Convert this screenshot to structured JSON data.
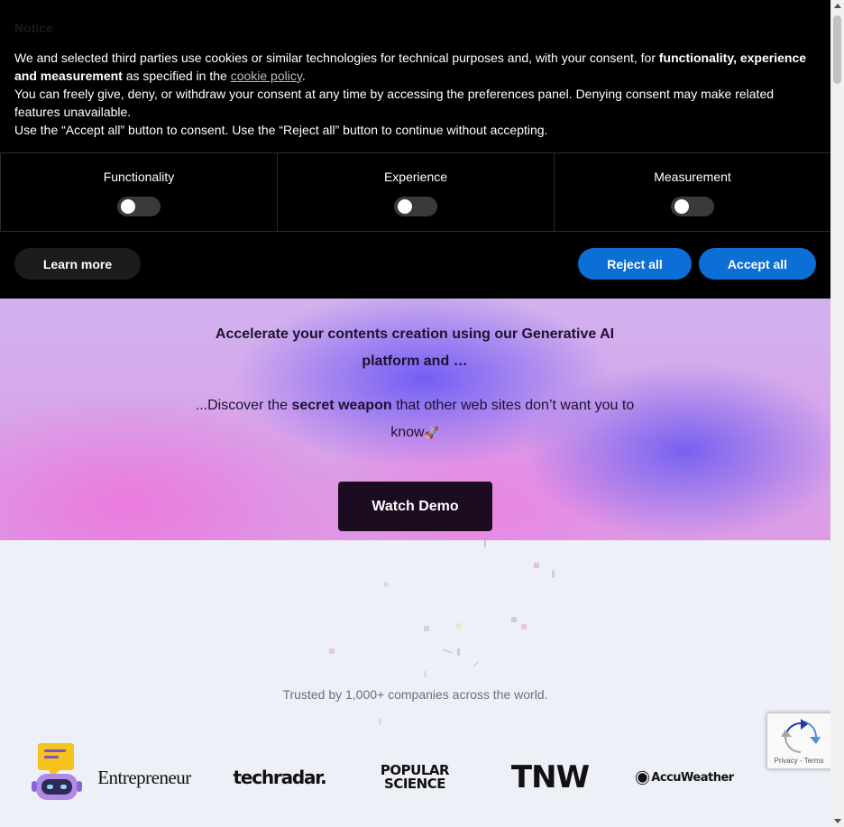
{
  "cookie_banner": {
    "title": "Notice",
    "text_part1": "We and selected third parties use cookies or similar technologies for technical purposes and, with your consent, for ",
    "text_bold": "functionality, experience and measurement",
    "text_part2": " as specified in the ",
    "policy_link": "cookie policy",
    "text_period": ".",
    "line2": "You can freely give, deny, or withdraw your consent at any time by accessing the preferences panel. Denying consent may make related features unavailable.",
    "line3": "Use the “Accept all” button to consent. Use the “Reject all” button to continue without accepting.",
    "preferences": [
      {
        "label": "Functionality",
        "enabled": false
      },
      {
        "label": "Experience",
        "enabled": false
      },
      {
        "label": "Measurement",
        "enabled": false
      }
    ],
    "learn_more_label": "Learn more",
    "reject_label": "Reject all",
    "accept_label": "Accept all",
    "accent_color": "#0b6fd6"
  },
  "hero": {
    "title": "Accelerate  your contents creation using our Generative AI platform and …",
    "sub_part1": "...Discover the ",
    "sub_bold": "secret weapon",
    "sub_part2": " that other web sites don’t want you to know",
    "sub_emoji": "🚀",
    "cta_label": "Watch Demo"
  },
  "trusted": {
    "text": "Trusted by 1,000+ companies across the world.",
    "logos": [
      "Entrepreneur",
      "techradar.",
      "POPULAR",
      "SCIENCE",
      "TNW",
      "AccuWeather"
    ]
  },
  "recaptcha": {
    "links": "Privacy - Terms"
  }
}
